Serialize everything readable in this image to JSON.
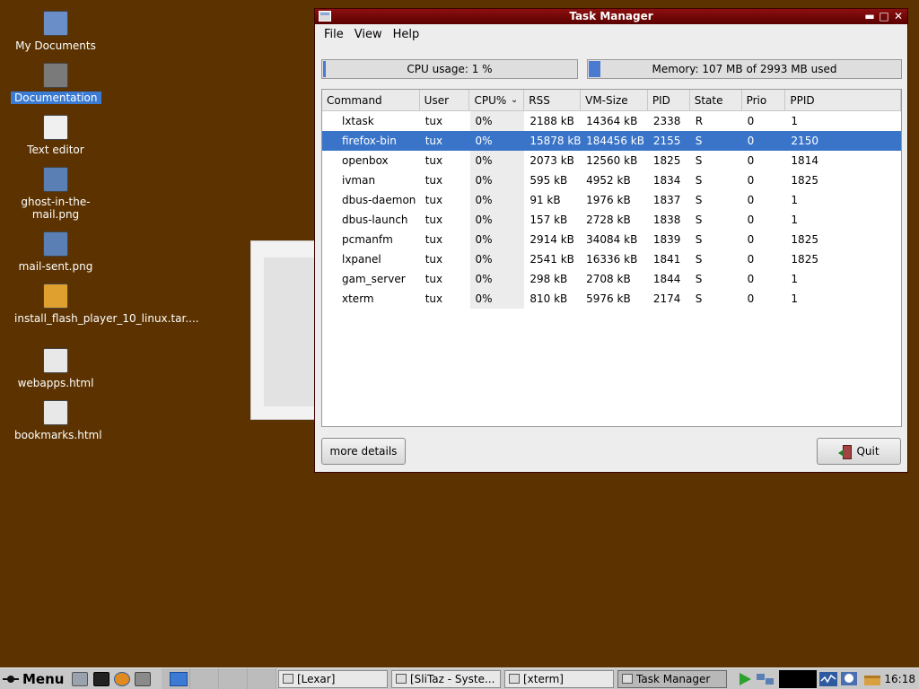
{
  "desktop": {
    "icons": [
      {
        "label": "My Documents",
        "icon": "home-folder-icon"
      },
      {
        "label": "Documentation",
        "icon": "spider-icon",
        "selected": true
      },
      {
        "label": "Text editor",
        "icon": "text-editor-icon"
      },
      {
        "label": "ghost-in-the-mail.png",
        "icon": "image-file-icon"
      },
      {
        "label": "mail-sent.png",
        "icon": "image-file-icon"
      },
      {
        "label": "install_flash_player_10_linux.tar....",
        "icon": "archive-icon"
      },
      {
        "label": "webapps.html",
        "icon": "html-file-icon"
      },
      {
        "label": "bookmarks.html",
        "icon": "html-file-icon"
      }
    ]
  },
  "window": {
    "title": "Task Manager",
    "menus": [
      "File",
      "View",
      "Help"
    ],
    "cpu_meter": {
      "text": "CPU usage: 1 %",
      "fraction": 0.01
    },
    "mem_meter": {
      "text": "Memory: 107 MB of 2993 MB used",
      "fraction": 0.036
    },
    "columns": [
      "Command",
      "User",
      "CPU%",
      "RSS",
      "VM-Size",
      "PID",
      "State",
      "Prio",
      "PPID"
    ],
    "sorted_column": "CPU%",
    "processes": [
      {
        "cmd": "lxtask",
        "user": "tux",
        "cpu": "0%",
        "rss": "2188 kB",
        "vm": "14364 kB",
        "pid": "2338",
        "state": "R",
        "prio": "0",
        "ppid": "1"
      },
      {
        "cmd": "firefox-bin",
        "user": "tux",
        "cpu": "0%",
        "rss": "15878 kB",
        "vm": "184456 kB",
        "pid": "2155",
        "state": "S",
        "prio": "0",
        "ppid": "2150",
        "selected": true
      },
      {
        "cmd": "openbox",
        "user": "tux",
        "cpu": "0%",
        "rss": "2073 kB",
        "vm": "12560 kB",
        "pid": "1825",
        "state": "S",
        "prio": "0",
        "ppid": "1814"
      },
      {
        "cmd": "ivman",
        "user": "tux",
        "cpu": "0%",
        "rss": "595 kB",
        "vm": "4952 kB",
        "pid": "1834",
        "state": "S",
        "prio": "0",
        "ppid": "1825"
      },
      {
        "cmd": "dbus-daemon",
        "user": "tux",
        "cpu": "0%",
        "rss": "91 kB",
        "vm": "1976 kB",
        "pid": "1837",
        "state": "S",
        "prio": "0",
        "ppid": "1"
      },
      {
        "cmd": "dbus-launch",
        "user": "tux",
        "cpu": "0%",
        "rss": "157 kB",
        "vm": "2728 kB",
        "pid": "1838",
        "state": "S",
        "prio": "0",
        "ppid": "1"
      },
      {
        "cmd": "pcmanfm",
        "user": "tux",
        "cpu": "0%",
        "rss": "2914 kB",
        "vm": "34084 kB",
        "pid": "1839",
        "state": "S",
        "prio": "0",
        "ppid": "1825"
      },
      {
        "cmd": "lxpanel",
        "user": "tux",
        "cpu": "0%",
        "rss": "2541 kB",
        "vm": "16336 kB",
        "pid": "1841",
        "state": "S",
        "prio": "0",
        "ppid": "1825"
      },
      {
        "cmd": "gam_server",
        "user": "tux",
        "cpu": "0%",
        "rss": "298 kB",
        "vm": "2708 kB",
        "pid": "1844",
        "state": "S",
        "prio": "0",
        "ppid": "1"
      },
      {
        "cmd": "xterm",
        "user": "tux",
        "cpu": "0%",
        "rss": "810 kB",
        "vm": "5976 kB",
        "pid": "2174",
        "state": "S",
        "prio": "0",
        "ppid": "1"
      }
    ],
    "details_button": "more details",
    "quit_button": "Quit"
  },
  "taskbar": {
    "menu_label": "Menu",
    "tasks": [
      {
        "label": "[Lexar]",
        "icon": "folder-icon"
      },
      {
        "label": "[SliTaz - Syste...",
        "icon": "firefox-icon"
      },
      {
        "label": "[xterm]",
        "icon": "terminal-icon"
      },
      {
        "label": "Task Manager",
        "icon": "window-icon",
        "active": true
      }
    ],
    "clock": "16:18"
  }
}
